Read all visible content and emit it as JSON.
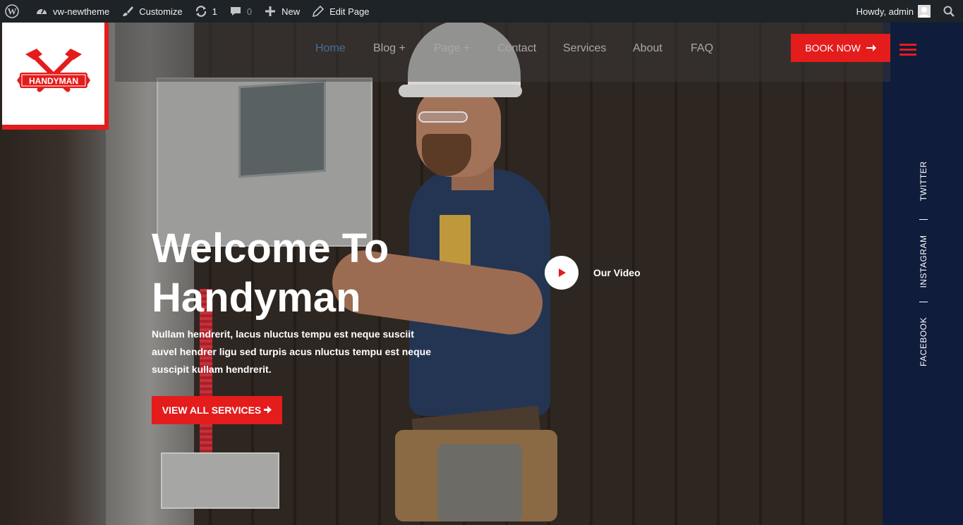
{
  "adminbar": {
    "site_name": "vw-newtheme",
    "customize": "Customize",
    "updates_count": "1",
    "comments_count": "0",
    "new": "New",
    "edit_page": "Edit Page",
    "howdy": "Howdy, admin"
  },
  "logo": {
    "text": "HANDYMAN"
  },
  "nav": {
    "items": [
      "Home",
      "Blog +",
      "Page +",
      "Contact",
      "Services",
      "About",
      "FAQ"
    ],
    "active": "Home",
    "book_label": "BOOK NOW"
  },
  "social": [
    "TWITTER",
    "INSTAGRAM",
    "FACEBOOK"
  ],
  "hero": {
    "title_line1": "Welcome To",
    "title_line2": "Handyman",
    "description": "Nullam hendrerit, lacus nluctus tempu est neque susciit auvel hendrer ligu sed turpis acus nluctus tempu est neque suscipit kullam hendrerit.",
    "cta_label": "VIEW ALL SERVICES",
    "video_label": "Our Video"
  },
  "colors": {
    "accent": "#e41c1c",
    "nav_active": "#4d97e8",
    "side_panel": "#0f1c3b",
    "adminbar": "#1d2327"
  }
}
